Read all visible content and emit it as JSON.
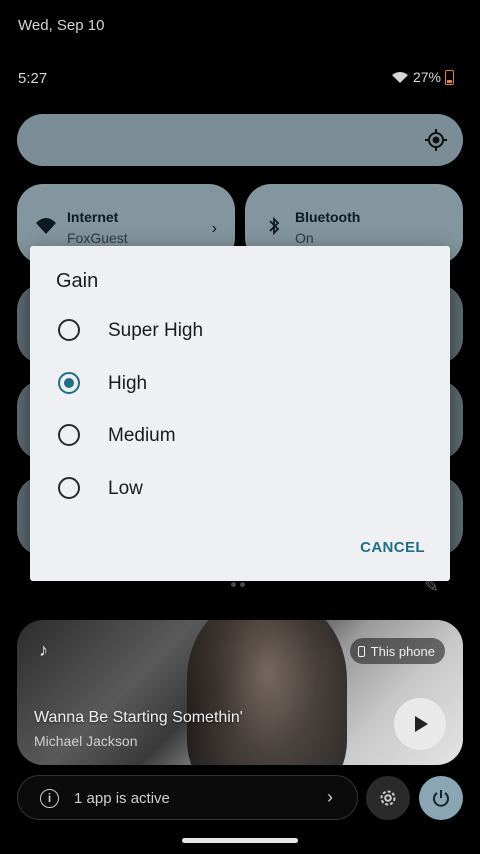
{
  "status_bar": {
    "date": "Wed, Sep 10",
    "time": "5:27",
    "battery": "27%"
  },
  "tiles": [
    {
      "title": "Internet",
      "subtitle": "FoxGuest",
      "icon": "wifi-icon"
    },
    {
      "title": "Bluetooth",
      "subtitle": "On",
      "icon": "bluetooth-icon"
    }
  ],
  "media": {
    "song": "Wanna Be Starting Somethin'",
    "artist": "Michael Jackson",
    "output": "This phone"
  },
  "footer": {
    "active_apps": "1 app is active"
  },
  "dialog": {
    "title": "Gain",
    "options": [
      "Super High",
      "High",
      "Medium",
      "Low"
    ],
    "selected": "High",
    "cancel_label": "CANCEL"
  },
  "colors": {
    "accent": "#1d6f86",
    "tile": "#83959e",
    "dialog_bg": "#eef0f3"
  }
}
